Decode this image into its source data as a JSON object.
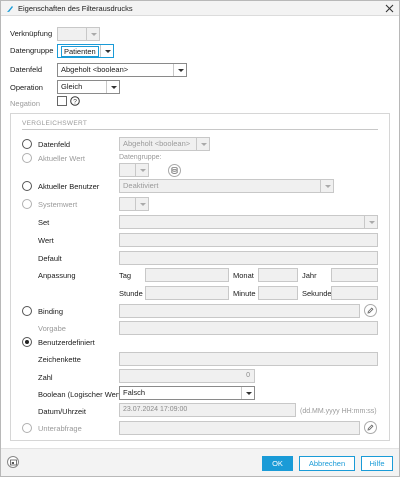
{
  "window": {
    "title": "Eigenschaften des Filterausdrucks"
  },
  "top": {
    "verknuepfung_label": "Verknüpfung",
    "datengruppe_label": "Datengruppe",
    "datengruppe_value": "Patienten",
    "datenfeld_label": "Datenfeld",
    "datenfeld_value": "Abgeholt <boolean>",
    "operation_label": "Operation",
    "operation_value": "Gleich",
    "negation_label": "Negation"
  },
  "group": {
    "title": "VERGLEICHSWERT",
    "datenfeld_label": "Datenfeld",
    "datenfeld_value": "Abgeholt <boolean>",
    "aktueller_wert_label": "Aktueller Wert",
    "datengruppe_label": "Datengruppe:",
    "aktueller_benutzer_label": "Aktueller Benutzer",
    "aktueller_benutzer_value": "Deaktiviert",
    "systemwert_label": "Systemwert",
    "set_label": "Set",
    "wert_label": "Wert",
    "default_label": "Default",
    "anpassung_label": "Anpassung",
    "tag_label": "Tag",
    "monat_label": "Monat",
    "jahr_label": "Jahr",
    "stunde_label": "Stunde",
    "minute_label": "Minute",
    "sekunde_label": "Sekunde",
    "binding_label": "Binding",
    "vorgabe_label": "Vorgabe",
    "benutzerdefiniert_label": "Benutzerdefiniert",
    "zeichenkette_label": "Zeichenkette",
    "zahl_label": "Zahl",
    "zahl_value": "0",
    "boolean_label": "Boolean (Logischer Wert)",
    "boolean_value": "Falsch",
    "datum_label": "Datum/Uhrzeit",
    "datum_value": "23.07.2024 17:09:00",
    "datum_format": "(dd.MM.yyyy HH:mm:ss)",
    "unterabfrage_label": "Unterabfrage"
  },
  "footer": {
    "ok_label": "OK",
    "abbrechen_label": "Abbrechen",
    "hilfe_label": "Hilfe"
  },
  "colors": {
    "accent": "#1a9bd7",
    "title_bar": "#f3f3f3",
    "border": "#c8c8c8"
  }
}
